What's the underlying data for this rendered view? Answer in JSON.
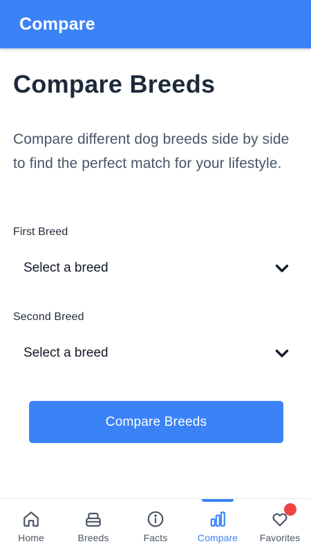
{
  "app_bar": {
    "title": "Compare"
  },
  "main": {
    "title": "Compare Breeds",
    "description": "Compare different dog breeds side by side to find the perfect match for your lifestyle."
  },
  "first_breed": {
    "label": "First Breed",
    "value": "Select a breed"
  },
  "second_breed": {
    "label": "Second Breed",
    "value": "Select a breed"
  },
  "compare_button": {
    "label": "Compare Breeds"
  },
  "bottom_nav": {
    "items": [
      {
        "label": "Home",
        "icon": "home-icon"
      },
      {
        "label": "Breeds",
        "icon": "breeds-icon"
      },
      {
        "label": "Facts",
        "icon": "info-icon"
      },
      {
        "label": "Compare",
        "icon": "bar-chart-icon",
        "active": true
      },
      {
        "label": "Favorites",
        "icon": "heart-icon",
        "badge": true
      }
    ]
  },
  "colors": {
    "primary": "#3b82f6",
    "badge": "#ef4444",
    "heading": "#1e293b",
    "body_text": "#475569"
  }
}
